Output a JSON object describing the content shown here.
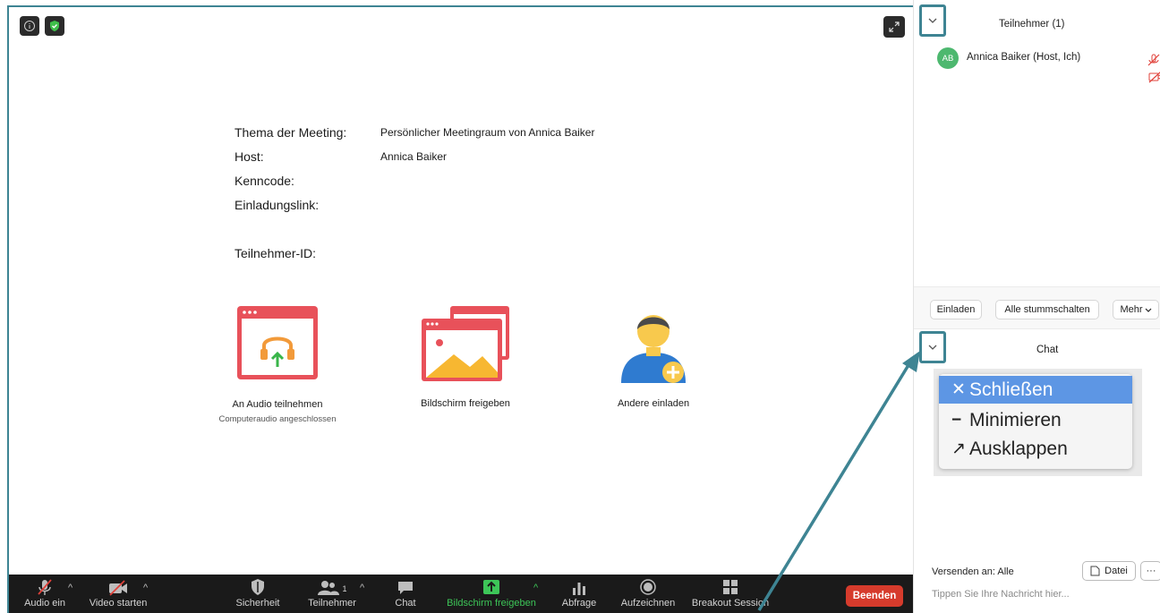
{
  "meeting_info": {
    "topic_label": "Thema der Meeting:",
    "topic_value": "Persönlicher Meetingraum von Annica Baiker",
    "host_label": "Host:",
    "host_value": "Annica Baiker",
    "passcode_label": "Kenncode:",
    "invite_link_label": "Einladungslink:",
    "participant_id_label": "Teilnehmer-ID:"
  },
  "actions": {
    "audio_label": "An Audio teilnehmen",
    "audio_sub": "Computeraudio angeschlossen",
    "share_label": "Bildschirm freigeben",
    "invite_label": "Andere einladen"
  },
  "toolbar": {
    "audio": "Audio ein",
    "video": "Video starten",
    "security": "Sicherheit",
    "participants": "Teilnehmer",
    "participants_count": "1",
    "chat": "Chat",
    "share": "Bildschirm freigeben",
    "poll": "Abfrage",
    "record": "Aufzeichnen",
    "breakout": "Breakout Session",
    "end": "Beenden"
  },
  "participants_panel": {
    "title": "Teilnehmer (1)",
    "avatar_initials": "AB",
    "participant_name": "Annica Baiker (Host, Ich)",
    "invite": "Einladen",
    "mute_all": "Alle stummschalten",
    "more": "Mehr"
  },
  "chat_panel": {
    "title": "Chat",
    "send_to": "Versenden an: Alle",
    "file": "Datei",
    "more_glyph": "···",
    "input_placeholder": "Tippen Sie Ihre Nachricht hier..."
  },
  "window_menu": {
    "close": "Schließen",
    "minimize": "Minimieren",
    "expand": "Ausklappen"
  },
  "colors": {
    "accent_teal": "#3e8493",
    "toolbar_bg": "#1a1a1a",
    "end_button": "#d63b2c",
    "share_green": "#3dc658",
    "menu_highlight": "#5d96e4"
  }
}
